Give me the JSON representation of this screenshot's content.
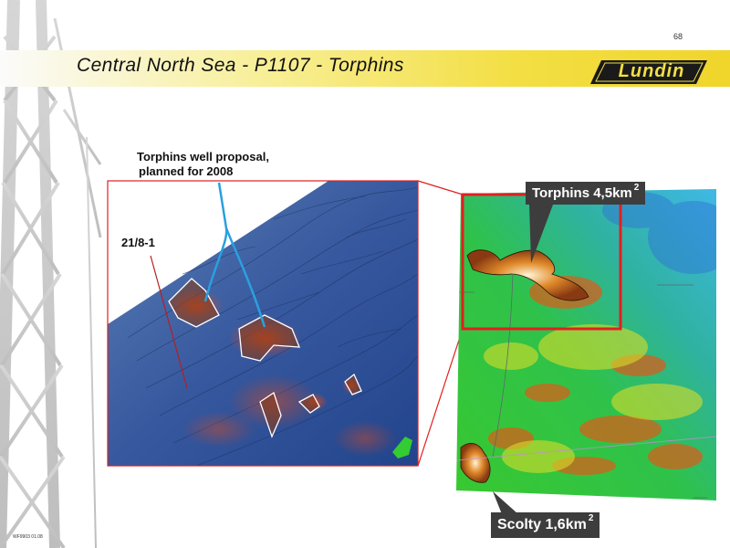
{
  "header": {
    "page_number": "68",
    "title": "Central North Sea - P1107 - Torphins",
    "logo_text": "Lundin"
  },
  "left_map": {
    "annotation_line1": "Torphins well proposal,",
    "annotation_line2": "planned for 2008",
    "well_label": "21/8-1"
  },
  "right_map": {
    "torphins_label": "Torphins 4,5km",
    "torphins_unit_exp": "2",
    "scolty_label": "Scolty 1,6km",
    "scolty_unit_exp": "2"
  },
  "footer": {
    "code": "WF9903 01.08"
  },
  "colors": {
    "title_band": "#f3df45",
    "highlight_box": "#e02020",
    "callout_bg": "#3d3d3d",
    "seismic_blue": "#2d4f98",
    "seismic_green": "#2fc24a",
    "well_track": "#2aa0e0"
  }
}
